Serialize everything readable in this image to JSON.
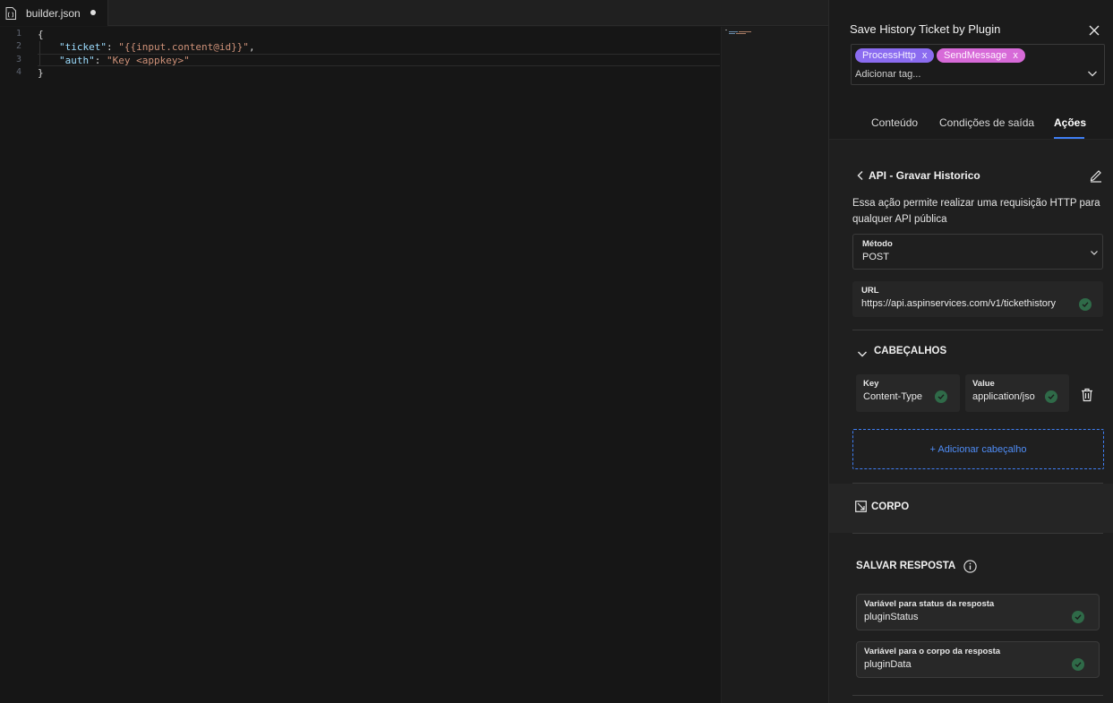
{
  "editor": {
    "tab_name": "builder.json",
    "line_numbers": [
      "1",
      "2",
      "3",
      "4"
    ],
    "lines": {
      "l1": "{",
      "l2_key": "\"ticket\"",
      "l2_sep": ": ",
      "l2_val": "\"{{input.content@id}}\"",
      "l2_end": ",",
      "l3_key": "\"auth\"",
      "l3_sep": ": ",
      "l3_val": "\"Key <appkey>\"",
      "l4": "}"
    }
  },
  "panel": {
    "title": "Save History Ticket by Plugin",
    "tags": [
      {
        "label": "ProcessHttp",
        "remove": "x",
        "color": "#8b6cf0"
      },
      {
        "label": "SendMessage",
        "remove": "x",
        "color": "#d76ad8"
      }
    ],
    "tag_placeholder": "Adicionar tag...",
    "tabs": [
      {
        "label": "Conteúdo"
      },
      {
        "label": "Condições de saída"
      },
      {
        "label": "Ações"
      }
    ],
    "accent_color": "#3f7ff5",
    "action": {
      "title": "API - Gravar Historico",
      "description": "Essa ação permite realizar uma requisição HTTP para qualquer API pública",
      "method_label": "Método",
      "method_value": "POST",
      "url_label": "URL",
      "url_value": "https://api.aspinservices.com/v1/tickethistory",
      "headers_title": "CABEÇALHOS",
      "header_key_label": "Key",
      "header_key_value": "Content-Type",
      "header_value_label": "Value",
      "header_value_value": "application/jso",
      "add_header": "+ Adicionar cabeçalho",
      "body_title": "CORPO",
      "save_title": "SALVAR RESPOSTA",
      "status_var_label": "Variável para status da resposta",
      "status_var_value": "pluginStatus",
      "body_var_label": "Variável para o corpo da resposta",
      "body_var_value": "pluginData"
    }
  }
}
